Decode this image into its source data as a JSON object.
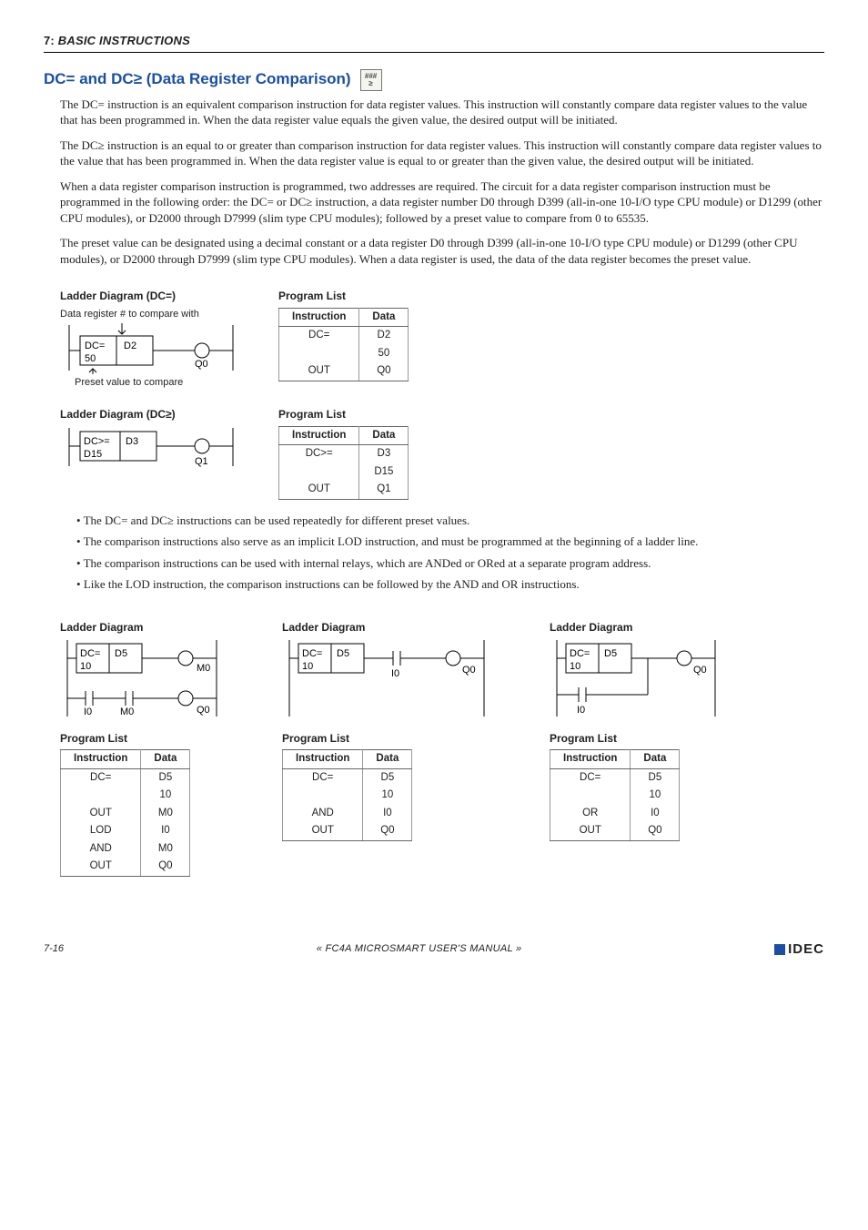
{
  "topbar": {
    "chapter": "7:",
    "title": "BASIC INSTRUCTIONS"
  },
  "heading": {
    "text": "DC= and DC≥ (Data Register Comparison)",
    "iconTop": "###",
    "iconBottom": "≥"
  },
  "paras": {
    "p1": "The DC= instruction is an equivalent comparison instruction for data register values. This instruction will constantly compare data register values to the value that has been programmed in. When the data register value equals the given value, the desired output will be initiated.",
    "p2": "The DC≥ instruction is an equal to or greater than comparison instruction for data register values. This instruction will constantly compare data register values to the value that has been programmed in. When the data register value is equal to or greater than the given value, the desired output will be initiated.",
    "p3": "When a data register comparison instruction is programmed, two addresses are required. The circuit for a data register comparison instruction must be programmed in the following order: the DC= or DC≥ instruction, a data register number D0 through D399 (all-in-one 10-I/O type CPU module) or D1299 (other CPU modules), or D2000 through D7999 (slim type CPU modules); followed by a preset value to compare from 0 to 65535.",
    "p4": "The preset value can be designated using a decimal constant or a data register D0 through D399 (all-in-one 10-I/O type CPU module) or D1299 (other CPU modules), or D2000 through D7999 (slim type CPU modules). When a data register is used, the data of the data register becomes the preset value."
  },
  "ladderDCeq": {
    "heading": "Ladder Diagram (DC=)",
    "noteTop": "Data register # to compare with",
    "noteBottom": "Preset value to compare",
    "box1": "DC=",
    "box2": "D2",
    "box3": "50",
    "out": "Q0"
  },
  "proglistDCeq": {
    "heading": "Program List",
    "cols": [
      "Instruction",
      "Data"
    ],
    "rows": [
      [
        "DC=",
        "D2"
      ],
      [
        "",
        "50"
      ],
      [
        "OUT",
        "Q0"
      ]
    ]
  },
  "ladderDCge": {
    "heading": "Ladder Diagram (DC≥)",
    "box1": "DC>=",
    "box2": "D3",
    "box3": "D15",
    "out": "Q1"
  },
  "proglistDCge": {
    "heading": "Program List",
    "cols": [
      "Instruction",
      "Data"
    ],
    "rows": [
      [
        "DC>=",
        "D3"
      ],
      [
        "",
        "D15"
      ],
      [
        "OUT",
        "Q1"
      ]
    ]
  },
  "bullets": [
    "The DC= and DC≥ instructions can be used repeatedly for different preset values.",
    "The comparison instructions also serve as an implicit LOD instruction, and must be programmed at the beginning of a ladder line.",
    "The comparison instructions can be used with internal relays, which are ANDed or ORed at a separate program address.",
    "Like the LOD instruction, the comparison instructions can be followed by the AND and OR instructions."
  ],
  "triplets": {
    "hLadder": "Ladder Diagram",
    "hProg": "Program List",
    "cols": [
      "Instruction",
      "Data"
    ],
    "A": {
      "ladder": {
        "op": "DC=",
        "reg": "D5",
        "val": "10",
        "out1": "M0",
        "in": "I0",
        "mid": "M0",
        "out2": "Q0"
      },
      "rows": [
        [
          "DC=",
          "D5"
        ],
        [
          "",
          "10"
        ],
        [
          "OUT",
          "M0"
        ],
        [
          "LOD",
          "I0"
        ],
        [
          "AND",
          "M0"
        ],
        [
          "OUT",
          "Q0"
        ]
      ]
    },
    "B": {
      "ladder": {
        "op": "DC=",
        "reg": "D5",
        "val": "10",
        "in": "I0",
        "out": "Q0"
      },
      "rows": [
        [
          "DC=",
          "D5"
        ],
        [
          "",
          "10"
        ],
        [
          "AND",
          "I0"
        ],
        [
          "OUT",
          "Q0"
        ]
      ]
    },
    "C": {
      "ladder": {
        "op": "DC=",
        "reg": "D5",
        "val": "10",
        "in": "I0",
        "out": "Q0"
      },
      "rows": [
        [
          "DC=",
          "D5"
        ],
        [
          "",
          "10"
        ],
        [
          "OR",
          "I0"
        ],
        [
          "OUT",
          "Q0"
        ]
      ]
    }
  },
  "footer": {
    "page": "7-16",
    "mid": "« FC4A MICROSMART USER'S MANUAL »",
    "brand": "IDEC"
  }
}
